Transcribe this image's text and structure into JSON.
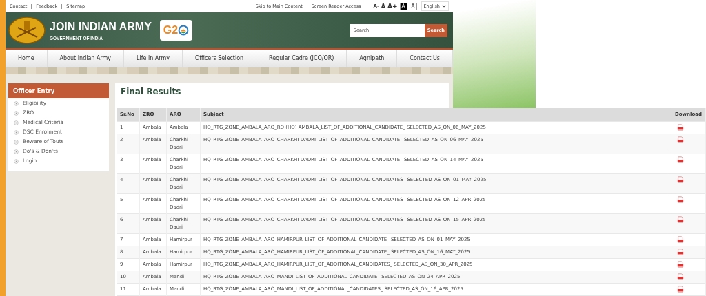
{
  "top_links": [
    "Contact",
    "Feedback",
    "Sitemap"
  ],
  "access_links": [
    "Skip to Main Content",
    "Screen Reader Access"
  ],
  "font_sizes": [
    "A-",
    "A",
    "A+"
  ],
  "contrast": [
    {
      "label": "A",
      "kind": "dark"
    },
    {
      "label": "A",
      "kind": "light"
    }
  ],
  "language": "English",
  "banner": {
    "title": "JOIN INDIAN ARMY",
    "subtitle": "GOVERNMENT OF INDIA",
    "logo_text": "G2"
  },
  "search": {
    "placeholder": "Search",
    "button": "Search"
  },
  "nav": [
    "Home",
    "About Indian Army",
    "Life in Army",
    "Officers Selection",
    "Regular Cadre (JCO/OR)",
    "Agnipath",
    "Contact Us"
  ],
  "sidebar": {
    "title": "Officer Entry",
    "items": [
      "Eligibility",
      "ZRO",
      "Medical Criteria",
      "DSC Enrolment",
      "Beware of Touts",
      "Do's & Don'ts",
      "Login"
    ]
  },
  "page_title": "Final Results",
  "table": {
    "columns": [
      "Sr.No",
      "ZRO",
      "ARO",
      "Subject",
      "Download"
    ],
    "rows": [
      [
        "1",
        "Ambala",
        "Ambala",
        "HQ_RTG_ZONE_AMBALA_ARO_RO (HQ) AMBALA_LIST_OF_ADDITIONAL_CANDIDATE_ SELECTED_AS_ON_06_MAY_2025"
      ],
      [
        "2",
        "Ambala",
        "Charkhi Dadri",
        "HQ_RTG_ZONE_AMBALA_ARO_CHARKHI DADRI_LIST_OF_ADDITIONAL_CANDIDATE_ SELECTED_AS_ON_06_MAY_2025"
      ],
      [
        "3",
        "Ambala",
        "Charkhi Dadri",
        "HQ_RTG_ZONE_AMBALA_ARO_CHARKHI DADRI_LIST_OF_ADDITIONAL_CANDIDATE_ SELECTED_AS_ON_14_MAY_2025"
      ],
      [
        "4",
        "Ambala",
        "Charkhi Dadri",
        "HQ_RTG_ZONE_AMBALA_ARO_CHARKHI DADRI_LIST_OF_ADDITIONAL_CANDIDATES_ SELECTED_AS_ON_01_MAY_2025"
      ],
      [
        "5",
        "Ambala",
        "Charkhi Dadri",
        "HQ_RTG_ZONE_AMBALA_ARO_CHARKHI DADRI_LIST_OF_ADDITIONAL_CANDIDATES_ SELECTED_AS_ON_12_APR_2025"
      ],
      [
        "6",
        "Ambala",
        "Charkhi Dadri",
        "HQ_RTG_ZONE_AMBALA_ARO_CHARKHI DADRI_LIST_OF_ADDITIONAL_CANDIDATES_ SELECTED_AS_ON_15_APR_2025"
      ],
      [
        "7",
        "Ambala",
        "Hamirpur",
        "HQ_RTG_ZONE_AMBALA_ARO_HAMIRPUR_LIST_OF_ADDITIONAL_CANDIDATE_ SELECTED_AS_ON_01_MAY_2025"
      ],
      [
        "8",
        "Ambala",
        "Hamirpur",
        "HQ_RTG_ZONE_AMBALA_ARO_HAMIRPUR_LIST_OF_ADDITIONAL_CANDIDATE_ SELECTED_AS_ON_16_MAY_2025"
      ],
      [
        "9",
        "Ambala",
        "Hamirpur",
        "HQ_RTG_ZONE_AMBALA_ARO_HAMIRPUR_LIST_OF_ADDITIONAL_CANDIDATES_ SELECTED_AS_ON_30_APR_2025"
      ],
      [
        "10",
        "Ambala",
        "Mandi",
        "HQ_RTG_ZONE_AMBALA_ARO_MANDI_LIST_OF_ADDITIONAL_CANDIDATE_ SELECTED_AS_ON_24_APR_2025"
      ],
      [
        "11",
        "Ambala",
        "Mandi",
        "HQ_RTG_ZONE_AMBALA_ARO_MANDI_LIST_OF_ADDITIONAL_CANDIDATES_ SELECTED_AS_ON_16_APR_2025"
      ]
    ]
  }
}
